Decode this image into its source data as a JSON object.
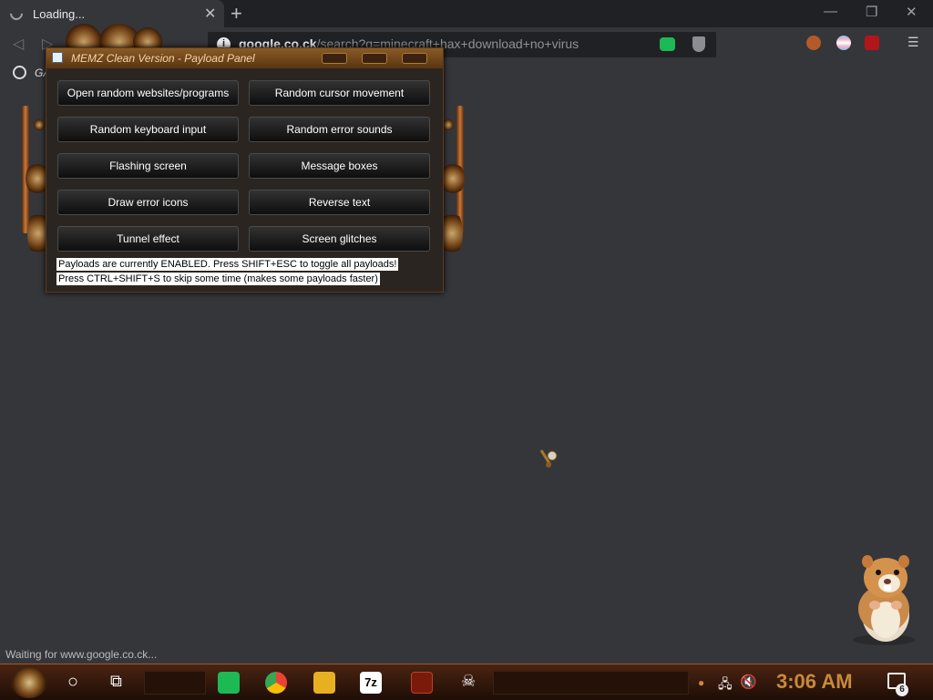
{
  "browser": {
    "tab_title": "Loading...",
    "url_host": "google.co.ck",
    "url_path": "/search?q=minecraft+hax+download+no+virus",
    "bookmark_label": "GA",
    "status": "Waiting for www.google.co.ck..."
  },
  "memz": {
    "title": "MEMZ Clean Version - Payload Panel",
    "buttons": [
      "Open random websites/programs",
      "Random cursor movement",
      "Random keyboard input",
      "Random error sounds",
      "Flashing screen",
      "Message boxes",
      "Draw error icons",
      "Reverse text",
      "Tunnel effect",
      "Screen glitches"
    ],
    "note_enabled": "Payloads are currently ENABLED. Press SHIFT+ESC to toggle all payloads!",
    "note_skip": "Press CTRL+SHIFT+S to skip some time (makes some payloads faster)"
  },
  "taskbar": {
    "clock": "3:06 AM",
    "notification_count": "6"
  },
  "icons": [
    "loading-spinner-icon",
    "close-icon",
    "plus-icon",
    "back-icon",
    "forward-icon",
    "info-icon",
    "globe-icon",
    "menu-icon",
    "start-icon",
    "cortana-icon",
    "task-view-icon",
    "chrome-icon",
    "folder-icon",
    "7zip-icon",
    "network-icon",
    "volume-icon",
    "notification-icon"
  ],
  "colors": {
    "browser_bg": "#35363a",
    "tabstrip": "#202124",
    "memz_title": "#f2d6a6",
    "clock": "#c88a3a"
  }
}
